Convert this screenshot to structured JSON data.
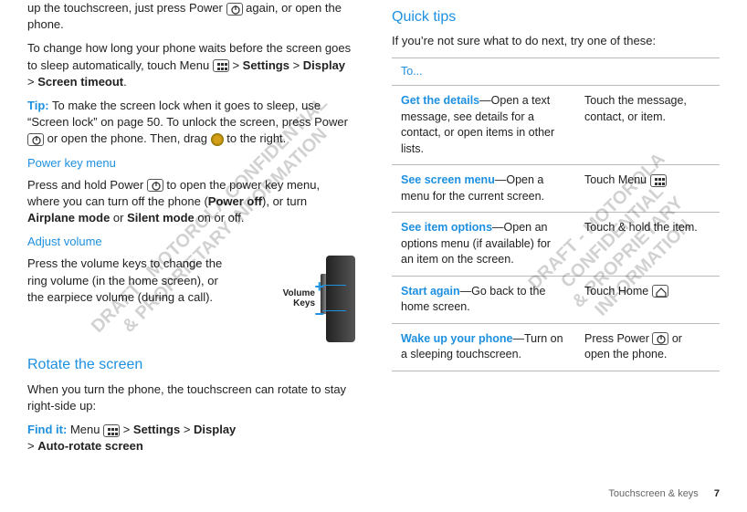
{
  "watermark": "DRAFT - MOTOROLA CONFIDENTIAL\n& PROPRIETARY INFORMATION",
  "left": {
    "p1a": "up the touchscreen, just press Power ",
    "p1b": " again, or open the phone.",
    "p2a": "To change how long your phone waits before the screen goes to sleep automatically, touch Menu ",
    "p2b": " > ",
    "p2_settings": "Settings",
    "p2_gt1": " > ",
    "p2_display": "Display",
    "p2_gt2": " > ",
    "p2_timeout": "Screen timeout",
    "p2_end": ".",
    "tip_label": "Tip:",
    "tip_a": " To make the screen lock when it goes to sleep, use “Screen lock” on page 50. To unlock the screen, press Power ",
    "tip_b": " or open the phone. Then, drag ",
    "tip_c": " to the right.",
    "h_power": "Power key menu",
    "power_a": "Press and hold Power ",
    "power_b": " to open the power key menu, where you can turn off the phone (",
    "power_bold1": "Power off",
    "power_c": "), or turn ",
    "power_bold2": "Airplane mode",
    "power_d": " or ",
    "power_bold3": "Silent mode",
    "power_e": " on or off.",
    "h_vol": "Adjust volume",
    "vol_text": "Press the volume keys to change the ring volume (in the home screen), or the earpiece volume (during a call).",
    "vol_label": "Volume\nKeys",
    "h_rotate": "Rotate the screen",
    "rotate_p": "When you turn the phone, the touchscreen can rotate to stay right-side up:",
    "findit_label": "Find it:",
    "findit_a": " Menu ",
    "findit_gt1": " > ",
    "findit_settings": "Settings",
    "findit_gt2": " > ",
    "findit_display": "Display",
    "findit_gt3": " > ",
    "findit_auto": "Auto-rotate screen"
  },
  "right": {
    "h_quick": "Quick tips",
    "intro": "If you’re not sure what to do next, try one of these:",
    "table_header": "To...",
    "rows": [
      {
        "head": "Get the details",
        "desc": "—Open a text message, see details for a contact, or open items in other lists.",
        "action": "Touch the message, contact, or item."
      },
      {
        "head": "See screen menu",
        "desc": "—Open a menu for the current screen.",
        "action_a": "Touch Menu ",
        "has_menu_icon": true
      },
      {
        "head": "See item options",
        "desc": "—Open an options menu (if available) for an item on the screen.",
        "action": "Touch & hold the item."
      },
      {
        "head": "Start again",
        "desc": "—Go back to the home screen.",
        "action_a": "Touch Home ",
        "has_home_icon": true
      },
      {
        "head": "Wake up your phone",
        "desc": "—Turn on a sleeping touchscreen.",
        "action_a": "Press Power ",
        "action_b": " or open the phone.",
        "has_power_icon": true
      }
    ]
  },
  "footer": {
    "section": "Touchscreen & keys",
    "page": "7"
  }
}
